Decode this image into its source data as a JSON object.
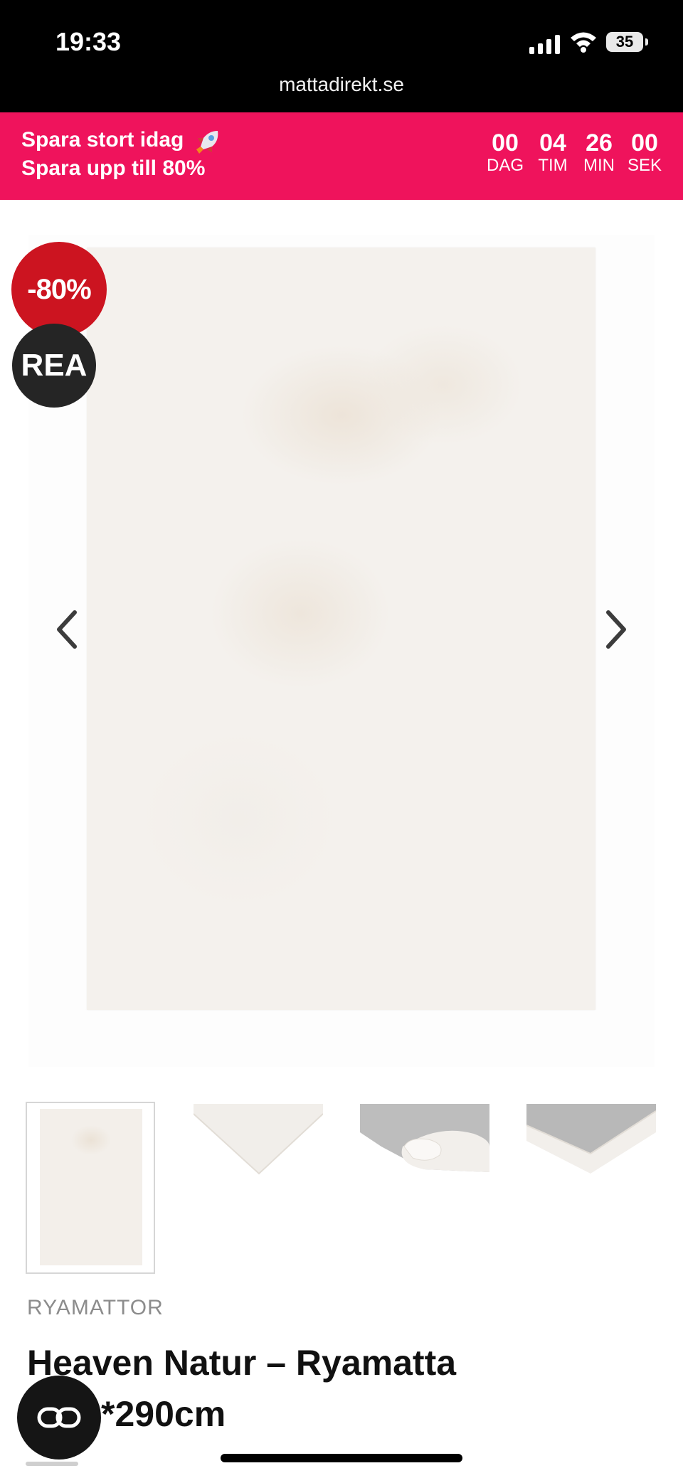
{
  "status_bar": {
    "time": "19:33",
    "battery": "35",
    "url": "mattadirekt.se"
  },
  "promo": {
    "line1": "Spara stort idag",
    "line2": "Spara upp till 80%",
    "countdown": [
      {
        "value": "00",
        "label": "DAG"
      },
      {
        "value": "04",
        "label": "TIM"
      },
      {
        "value": "26",
        "label": "MIN"
      },
      {
        "value": "00",
        "label": "SEK"
      }
    ],
    "colors": {
      "banner": "#ef135c"
    }
  },
  "product": {
    "badges": {
      "discount": "-80%",
      "sale": "REA"
    },
    "category": "RYAMATTOR",
    "title_line1": "Heaven Natur – Ryamatta",
    "title_line2": "*290cm",
    "thumbnails": [
      "rug-front",
      "rug-corner",
      "rug-rolled-side",
      "rug-folded-corner"
    ]
  },
  "icons": {
    "prev": "chevron-left-icon",
    "next": "chevron-right-icon",
    "float": "link-icon",
    "rocket": "rocket-icon"
  }
}
